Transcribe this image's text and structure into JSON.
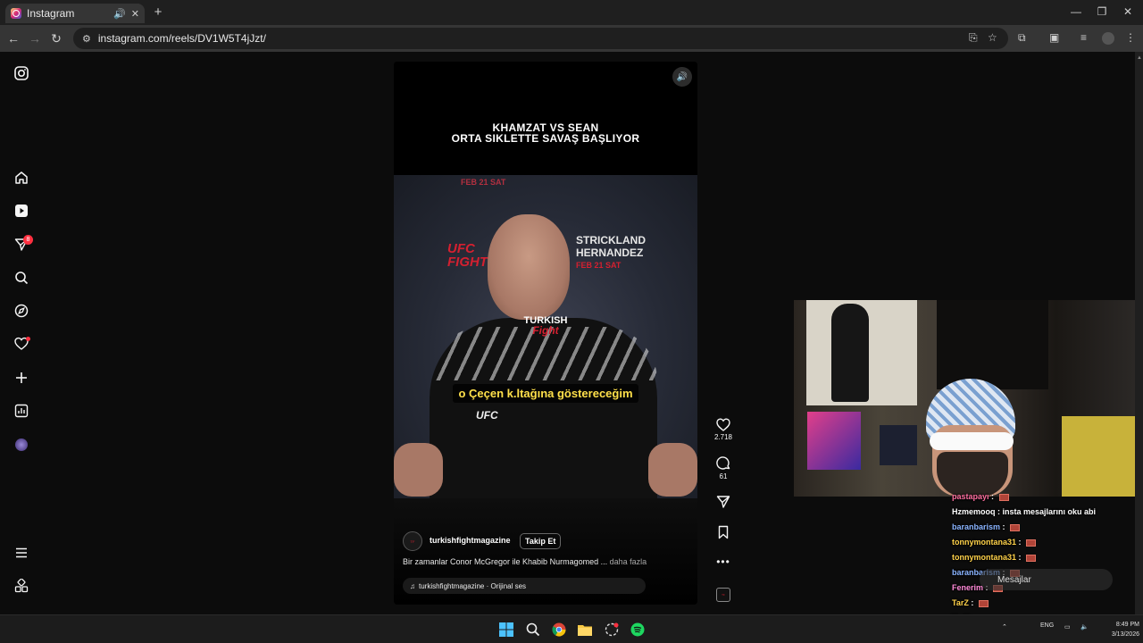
{
  "browser": {
    "tab_title": "Instagram",
    "new_tab": "+",
    "url": "instagram.com/reels/DV1W5T4jJzt/",
    "controls": {
      "minimize": "—",
      "restore": "❐",
      "close": "✕"
    }
  },
  "sidebar": {
    "notifications_badge": "8"
  },
  "reel": {
    "headline_line1": "KHAMZAT VS SEAN",
    "headline_line2": "ORTA SIKLETTE SAVAŞ BAŞLIYOR",
    "backdrop_top": "FEB 21 SAT",
    "backdrop_ufc_line1": "UFC",
    "backdrop_ufc_line2": "FIGHT",
    "backdrop_sponsor_line1": "STRICKLAND",
    "backdrop_sponsor_line2": "HERNANDEZ",
    "backdrop_sponsor_line3": "FEB 21 SAT",
    "shirt_logo": "UFC",
    "watermark_line1": "TURKISH",
    "watermark_line2": "Fight",
    "subtitle": "o Çeçen k.ltağına göstereceğim",
    "author": "turkishfightmagazine",
    "follow_label": "Takip Et",
    "description": "Bir zamanlar Conor McGregor ile Khabib Nurmagomed ...",
    "more_label": "daha fazla",
    "audio": "turkishfightmagazine · Orijinal ses"
  },
  "actions": {
    "likes": "2.718",
    "comments": "61"
  },
  "chat": {
    "messages": [
      {
        "user": "pastapayı",
        "color": "#ff6fa0",
        "text": "",
        "emote": true
      },
      {
        "user": "Hzmemooq",
        "color": "#ffffff",
        "text": "insta mesajlarını oku abi",
        "emote": false
      },
      {
        "user": "baranbarism",
        "color": "#8ab4ff",
        "text": "",
        "emote": true
      },
      {
        "user": "tonnymontana31",
        "color": "#ffd24a",
        "text": "",
        "emote": true
      },
      {
        "user": "tonnymontana31",
        "color": "#ffd24a",
        "text": "",
        "emote": true
      },
      {
        "user": "baranbarism",
        "color": "#8ab4ff",
        "text": "",
        "emote": true
      },
      {
        "user": "Fenerim",
        "color": "#ff8ad8",
        "text": "",
        "emote": true
      },
      {
        "user": "TarZ",
        "color": "#ffd24a",
        "text": "",
        "emote": true
      },
      {
        "user": "TarZ",
        "color": "#ffd24a",
        "text": "",
        "emote": true
      },
      {
        "user": "Hzmemooq",
        "color": "#ffffff",
        "text": "insta mesajlarını oku abi",
        "emote": false
      }
    ],
    "messages_label": "Mesajlar"
  },
  "taskbar": {
    "language": "ENG",
    "time": "8:49 PM",
    "date": "3/13/2026"
  },
  "colors": {
    "accent_red": "#ff3040",
    "subtitle_yellow": "#ffe04a"
  }
}
